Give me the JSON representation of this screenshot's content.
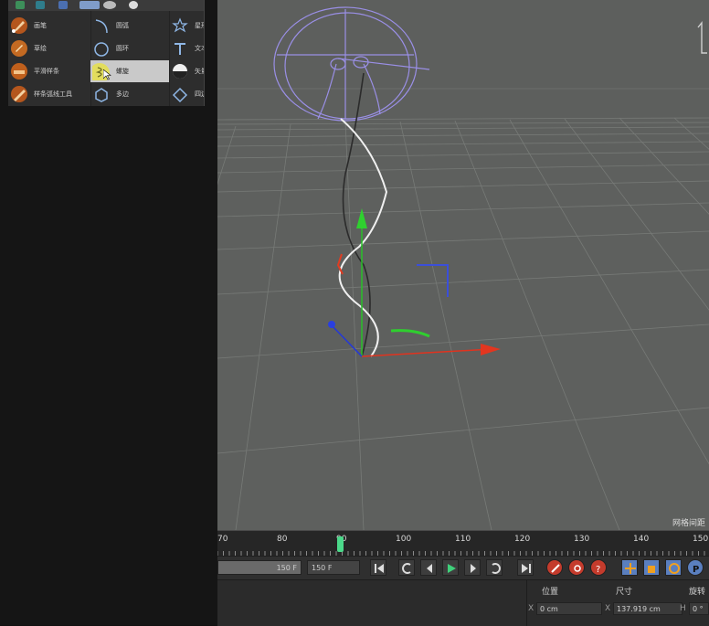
{
  "menu": {
    "col1": [
      {
        "label": "画笔",
        "icon": "pen-icon"
      },
      {
        "label": "草绘",
        "icon": "sketch-icon"
      },
      {
        "label": "平滑样条",
        "icon": "smooth-spline-icon"
      },
      {
        "label": "样条弧线工具",
        "icon": "spline-arc-tool-icon"
      }
    ],
    "col2": [
      {
        "label": "圆弧",
        "icon": "arc-icon"
      },
      {
        "label": "圆环",
        "icon": "circle-icon"
      },
      {
        "label": "螺旋",
        "icon": "helix-icon"
      },
      {
        "label": "多边",
        "icon": "polygon-icon"
      }
    ],
    "col3": [
      {
        "label": "星形",
        "icon": "star-icon"
      },
      {
        "label": "文本",
        "icon": "text-icon"
      },
      {
        "label": "矢量",
        "icon": "vectorizer-icon"
      },
      {
        "label": "四边",
        "icon": "four-side-icon"
      }
    ],
    "highlighted": "螺旋"
  },
  "viewport": {
    "grid_label": "网格间距"
  },
  "timeline": {
    "ticks": [
      "70",
      "80",
      "90",
      "100",
      "110",
      "120",
      "130",
      "140",
      "150"
    ],
    "current_frame": "90"
  },
  "transport": {
    "range_end": "150 F",
    "end_frame": "150 F"
  },
  "coords": {
    "position_header": "位置",
    "size_header": "尺寸",
    "rotation_header": "旋转",
    "x_label": "X",
    "position_x": "0 cm",
    "size_x": "137.919 cm",
    "h_label": "H",
    "rotation_h": "0 °"
  }
}
